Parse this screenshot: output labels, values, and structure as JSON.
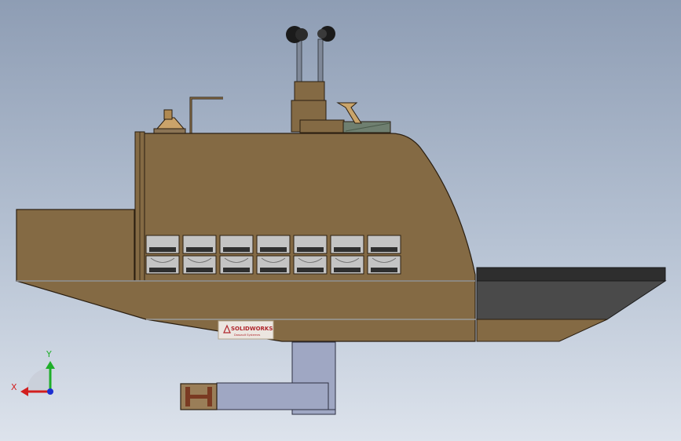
{
  "watermark": {
    "brand": "SOLIDWORKS",
    "tagline": "Dassault Systemes"
  },
  "triad": {
    "y_label": "Y",
    "x_label": "X",
    "y_color": "#1fae2a",
    "x_color": "#d21f1f",
    "z_color": "#1c2fd1"
  },
  "colors": {
    "hull": "#846a44",
    "hull_edge": "#2a1e10",
    "deck_dark": "#4a4a4a",
    "duct": "#9fa7c3",
    "window_glass": "#c4c4c4"
  }
}
